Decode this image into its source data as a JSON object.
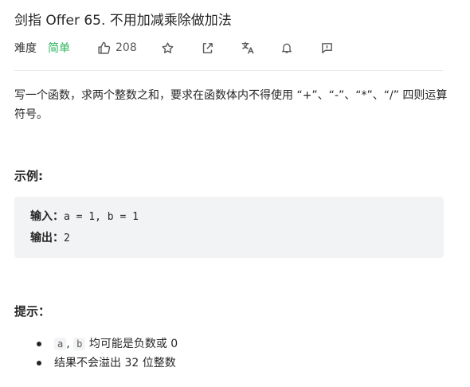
{
  "problem": {
    "title": "剑指 Offer 65. 不用加减乘除做加法",
    "difficulty_label": "难度",
    "difficulty": "简单",
    "like_count": "208",
    "icons": [
      "thumbs-up-icon",
      "star-icon",
      "share-icon",
      "translate-icon",
      "bell-icon",
      "feedback-icon"
    ],
    "difficulty_color": "#2db55d"
  },
  "description": {
    "text": "写一个函数，求两个整数之和，要求在函数体内不得使用 “+”、“-”、“*”、“/” 四则运算符号。"
  },
  "example": {
    "heading": "示例:",
    "input_label": "输入：",
    "input_value": "a = 1, b = 1",
    "output_label": "输出：",
    "output_value": "2"
  },
  "hints": {
    "heading": "提示：",
    "item1_code_a": "a",
    "item1_sep": ",",
    "item1_code_b": "b",
    "item1_text": " 均可能是负数或 0",
    "item2_text": "结果不会溢出 32 位整数"
  }
}
